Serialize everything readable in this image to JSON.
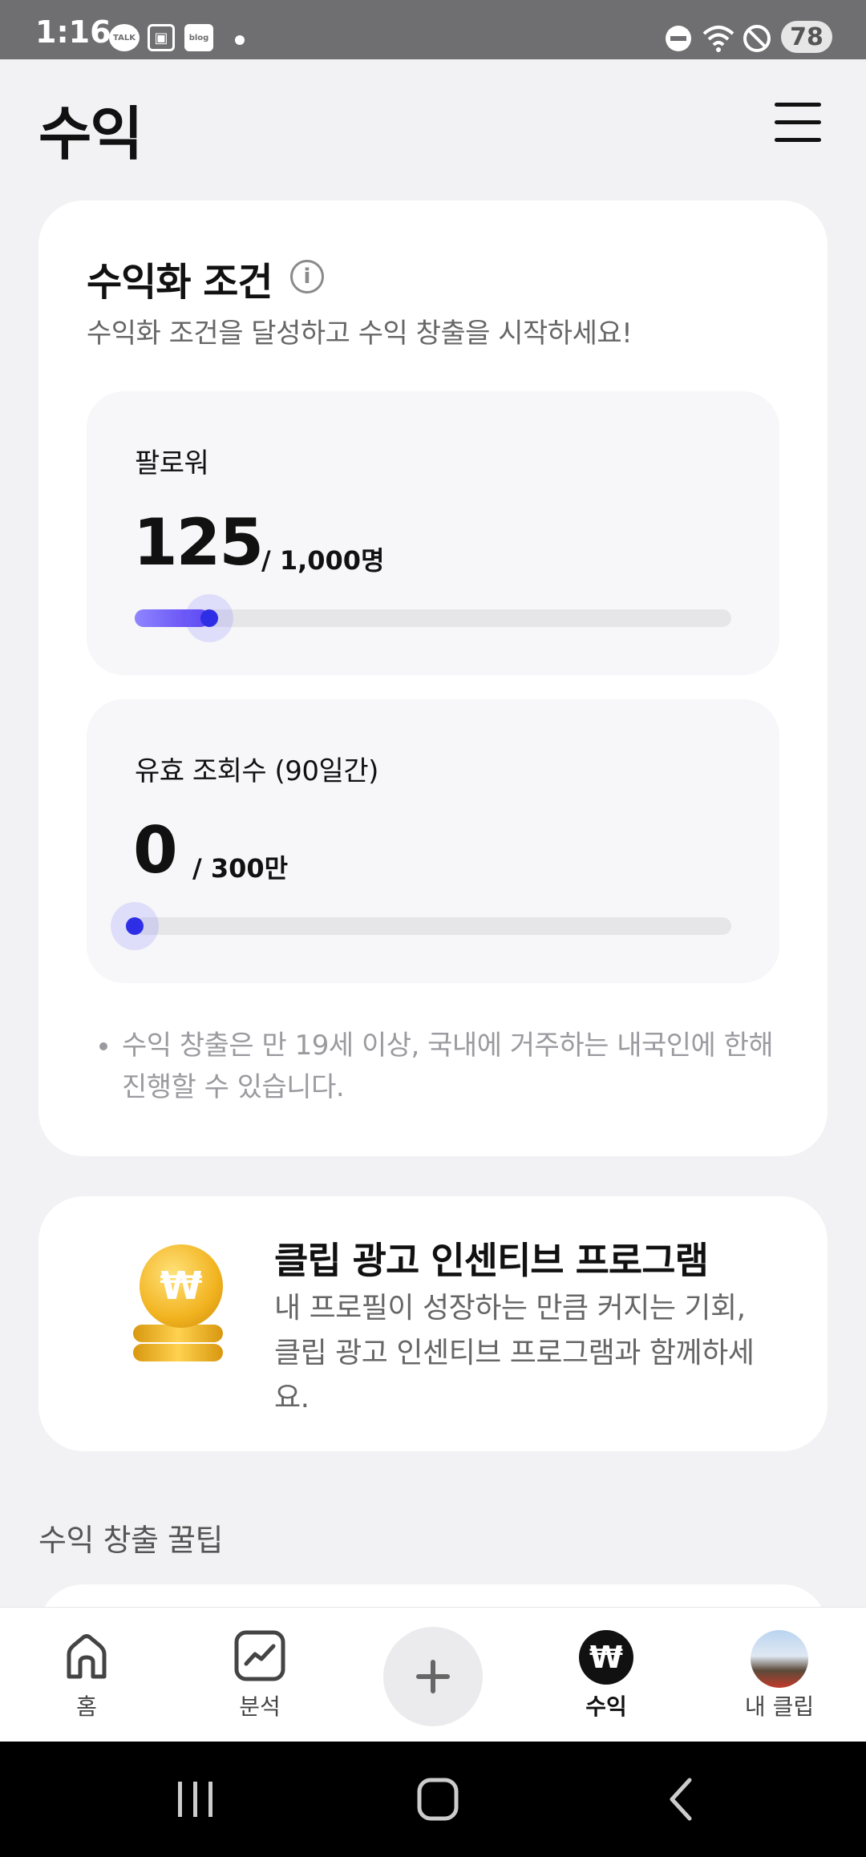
{
  "status_bar": {
    "time": "1:16",
    "notification_icons": [
      "TALK",
      "▣",
      "blog"
    ],
    "battery": "78"
  },
  "header": {
    "title": "수익"
  },
  "monetization": {
    "title": "수익화 조건",
    "subtitle": "수익화 조건을 달성하고 수익 창출을 시작하세요!",
    "metrics": [
      {
        "label": "팔로워",
        "value": "125",
        "target": "/ 1,000명",
        "progress": 0.125
      },
      {
        "label": "유효 조회수 (90일간)",
        "value": "0",
        "target": "/ 300만",
        "progress": 0.0
      }
    ],
    "notice": "수익 창출은 만 19세 이상, 국내에 거주하는 내국인에 한해 진행할 수 있습니다."
  },
  "incentive": {
    "title": "클립 광고 인센티브 프로그램",
    "description": "내 프로필이 성장하는 만큼 커지는 기회, 클립 광고 인센티브 프로그램과 함께하세요.",
    "coin_symbol": "₩"
  },
  "tips": {
    "title": "수익 창출 꿀팁"
  },
  "bottom_nav": {
    "items": [
      {
        "label": "홈",
        "icon": "home-icon"
      },
      {
        "label": "분석",
        "icon": "chart-icon"
      },
      {
        "label": "",
        "icon": "plus-icon"
      },
      {
        "label": "수익",
        "icon": "won-icon",
        "symbol": "₩"
      },
      {
        "label": "내 클립",
        "icon": "avatar"
      }
    ],
    "active": "수익"
  },
  "colors": {
    "accent": "#2e2ee6",
    "progress_start": "#8e86ff",
    "progress_end": "#5b3ff0",
    "status_bar": "#6f6f71"
  }
}
